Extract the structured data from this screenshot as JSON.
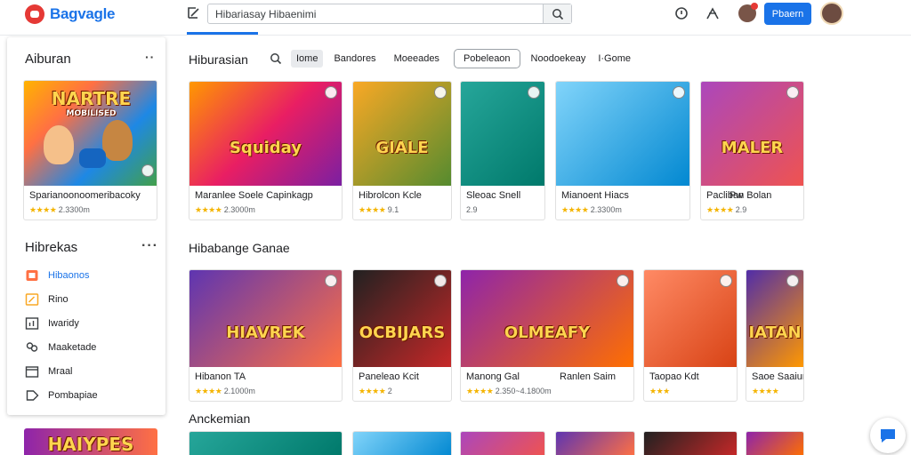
{
  "header": {
    "logo_text": "Bagvagle",
    "search_value": "Hibariasay Hibaenimi",
    "button_label": "Pbaern"
  },
  "sidebar": {
    "title": "Aiburan",
    "featured": {
      "title": "Sparianoonoomeribacoky",
      "meta": "2.3300m",
      "art_text": "NARTRE",
      "art_sub": "MOBILISED",
      "rating": 4.0
    },
    "section_title": "Hibrekas",
    "items": [
      {
        "label": "Hibaonos",
        "icon": "orange-square-icon",
        "active": true
      },
      {
        "label": "Rino",
        "icon": "badge-icon",
        "active": false
      },
      {
        "label": "Iwaridy",
        "icon": "chart-icon",
        "active": false
      },
      {
        "label": "Maaketade",
        "icon": "people-icon",
        "active": false
      },
      {
        "label": "Mraal",
        "icon": "calendar-icon",
        "active": false
      },
      {
        "label": "Pombapiae",
        "icon": "tag-icon",
        "active": false
      }
    ],
    "bottom_art_text": "HAIYPES"
  },
  "filters": {
    "title": "Hiburasian",
    "chips": [
      "Iome",
      "Bandores",
      "Moeeades",
      "Pobeleaon",
      "Noodoekeay",
      "I·Gome"
    ]
  },
  "row1": [
    {
      "title": "Maranlee Soele Capinkagp",
      "meta": "2.3000m",
      "art_text": "Squiday",
      "rating": 4.0
    },
    {
      "title": "Hibrolcon Kcle",
      "meta": "9.1",
      "art_text": "GIALE",
      "rating": 4.0
    },
    {
      "title": "Sleoac Snell",
      "meta": "2.9",
      "art_text": "",
      "rating": 0
    },
    {
      "title": "Mianoent Hiacs",
      "meta": "2.3300m",
      "art_text": "",
      "rating": 4.0
    },
    {
      "title": "Pacliban Bolan",
      "title_extra": "Pw",
      "meta": "2.9",
      "art_text": "MALER",
      "rating": 4.0
    }
  ],
  "section2": {
    "title": "Hibabange Ganae"
  },
  "row2": [
    {
      "title": "Hibanon TA",
      "meta": "2.1000m",
      "art_text": "HIAVREK",
      "rating": 4.0
    },
    {
      "title": "Paneleao Kcit",
      "meta": "2",
      "art_text": "OCBIJARS",
      "rating": 4.0
    },
    {
      "title": "Manong Gal",
      "title_extra": "Ranlen Saim",
      "meta": "2.350~4.1800m",
      "art_text": "OLMEAFY",
      "rating": 4.0
    },
    {
      "title": "Taopao Kdt",
      "meta": "",
      "art_text": "",
      "rating": 3.0
    },
    {
      "title": "Saoe Saaiunu",
      "meta": "",
      "art_text": "IATAN",
      "rating": 4.0
    }
  ],
  "section3": {
    "title": "Anckemian"
  }
}
